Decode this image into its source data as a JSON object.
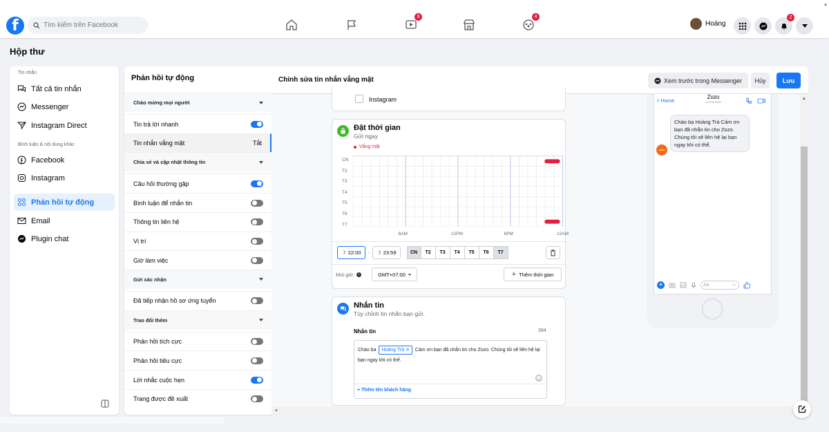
{
  "header": {
    "logo": "f",
    "search_placeholder": "Tìm kiếm trên Facebook",
    "user_name": "Hoàng",
    "badges": {
      "watch": "9",
      "groups": "4",
      "notifications": "2"
    }
  },
  "page_title": "Hộp thư",
  "left_nav": {
    "section_messages": "Tin nhắn",
    "all_messages": "Tất cả tin nhắn",
    "messenger": "Messenger",
    "instagram_direct": "Instagram Direct",
    "section_comments": "Bình luận & nội dung khác",
    "facebook": "Facebook",
    "instagram": "Instagram",
    "auto_reply": "Phản hồi tự động",
    "email": "Email",
    "plugin_chat": "Plugin chat"
  },
  "mid": {
    "title": "Phản hồi tự động",
    "rows": [
      {
        "label": "Chào mừng mọi người",
        "type": "group"
      },
      {
        "label": "Tin trả lời nhanh",
        "type": "toggle",
        "on": true
      },
      {
        "label": "Tin nhắn vắng mặt",
        "type": "selected",
        "value": "Tắt"
      },
      {
        "label": "Chia sẻ và cập nhật thông tin",
        "type": "group"
      },
      {
        "label": "Câu hỏi thường gặp",
        "type": "toggle",
        "on": true
      },
      {
        "label": "Bình luận để nhắn tin",
        "type": "toggle",
        "on": false
      },
      {
        "label": "Thông tin liên hệ",
        "type": "toggle",
        "on": false
      },
      {
        "label": "Vị trí",
        "type": "toggle",
        "on": false
      },
      {
        "label": "Giờ làm việc",
        "type": "toggle",
        "on": false
      },
      {
        "label": "Gửi xác nhận",
        "type": "group"
      },
      {
        "label": "Đã tiếp nhận hồ sơ ứng tuyển",
        "type": "toggle",
        "on": false
      },
      {
        "label": "Trao đổi thêm",
        "type": "group"
      },
      {
        "label": "Phản hồi tích cực",
        "type": "toggle",
        "on": false
      },
      {
        "label": "Phản hồi tiêu cực",
        "type": "toggle",
        "on": false
      },
      {
        "label": "Lời nhắc cuộc hẹn",
        "type": "toggle",
        "on": true
      },
      {
        "label": "Trang được đề xuất",
        "type": "toggle",
        "on": false
      }
    ]
  },
  "main": {
    "title": "Chỉnh sửa tin nhắn vắng mặt",
    "preview_btn": "Xem trước trong Messenger",
    "cancel_btn": "Hủy",
    "save_btn": "Lưu",
    "instagram_option": "Instagram",
    "schedule": {
      "title": "Đặt thời gian",
      "subtitle": "Gửi ngay",
      "legend": "Vắng mặt",
      "rows": [
        "CN",
        "T2",
        "T3",
        "T4",
        "T5",
        "T6",
        "T7"
      ],
      "x_ticks": [
        "6AM",
        "12PM",
        "6PM",
        "12AM"
      ],
      "start_time": "22:00",
      "end_time": "23:59",
      "days": [
        "CN",
        "T2",
        "T3",
        "T4",
        "T5",
        "T6",
        "T7"
      ],
      "timezone_label": "Múi giờ:",
      "timezone_value": "GMT+07:00",
      "add_time": "Thêm thời gian"
    },
    "message": {
      "title": "Nhắn tin",
      "subtitle": "Tùy chỉnh tin nhắn bạn gửi.",
      "label": "Nhắn tin",
      "count": "394",
      "text_before": "Chào ba",
      "chip": "Hoàng Trà",
      "text_after": "Cảm ơn bạn đã nhắn tin cho Zozo. Chúng tôi sẽ liên hệ lại bạn ngay khi có thể.",
      "add_name": "+ Thêm tên khách hàng"
    },
    "preview": {
      "back": "Home",
      "page_name": "Zozo",
      "status": "ACTIVE NOW",
      "bubble": "Chào bạ Hoàng Trà Cảm ơn bạn đã nhắn tin cho Zozo. Chúng tôi sẽ liên hệ lại bạn ngay khi có thể.",
      "avatar_text": "zozo",
      "input_placeholder": "Aa"
    }
  },
  "colors": {
    "accent": "#1877f2",
    "away": "#e41e3f"
  }
}
